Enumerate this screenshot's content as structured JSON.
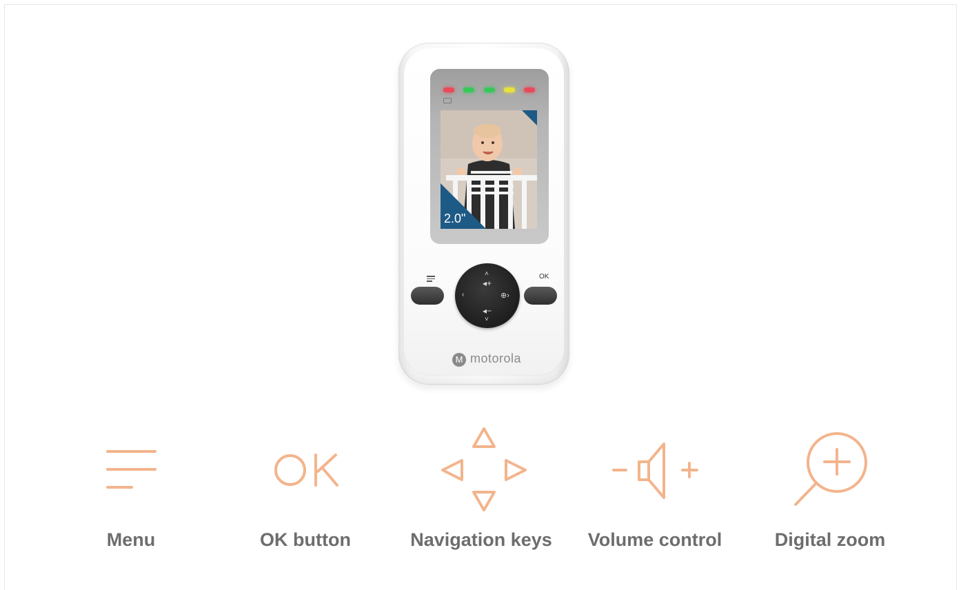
{
  "device": {
    "screen_size_label": "2.0\"",
    "ok_label": "OK",
    "brand": "motorola",
    "brand_mark": "M",
    "led_colors": [
      "#e84a5a",
      "#38c85a",
      "#38c85a",
      "#e6e23a",
      "#e84a5a"
    ]
  },
  "features": [
    {
      "label": "Menu",
      "icon": "menu-icon"
    },
    {
      "label": "OK button",
      "icon": "ok-icon"
    },
    {
      "label": "Navigation keys",
      "icon": "navigation-arrows-icon"
    },
    {
      "label": "Volume control",
      "icon": "volume-icon"
    },
    {
      "label": "Digital zoom",
      "icon": "zoom-in-icon"
    }
  ],
  "colors": {
    "icon_accent": "#f3b48c",
    "label_text": "#6d6d6d",
    "screen_accent": "#1e5a86"
  }
}
